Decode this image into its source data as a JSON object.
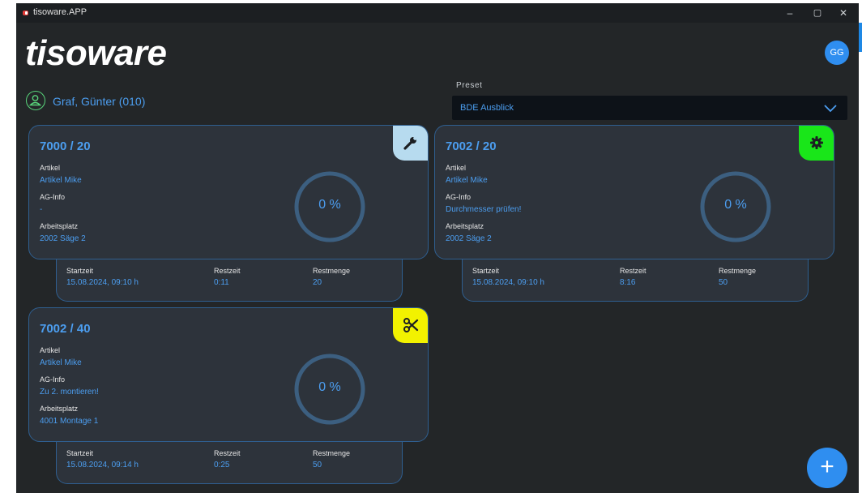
{
  "window": {
    "title": "tisoware.APP"
  },
  "controls": {
    "minimize": "–",
    "maximize": "▢",
    "close": "✕"
  },
  "header": {
    "logo": "tisoware",
    "avatar": "GG"
  },
  "user": {
    "name": "Graf, Günter (010)"
  },
  "preset": {
    "label": "Preset",
    "value": "BDE Ausblick"
  },
  "labels": {
    "artikel": "Artikel",
    "ag_info": "AG-Info",
    "arbeitsplatz": "Arbeitsplatz",
    "startzeit": "Startzeit",
    "restzeit": "Restzeit",
    "restmenge": "Restmenge"
  },
  "cards": [
    {
      "title": "7000 / 20",
      "artikel": "Artikel Mike",
      "ag_info": "-",
      "arbeitsplatz": "2002 Säge 2",
      "progress": "0 %",
      "startzeit": "15.08.2024, 09:10 h",
      "restzeit": "0:11",
      "restmenge": "20",
      "icon": "wrench-icon",
      "accent": "#b7dbef"
    },
    {
      "title": "7002 / 20",
      "artikel": "Artikel Mike",
      "ag_info": "Durchmesser prüfen!",
      "arbeitsplatz": "2002 Säge 2",
      "progress": "0 %",
      "startzeit": "15.08.2024, 09:10 h",
      "restzeit": "8:16",
      "restmenge": "50",
      "icon": "gear-icon",
      "accent": "#19e619"
    },
    {
      "title": "7002 / 40",
      "artikel": "Artikel Mike",
      "ag_info": "Zu 2. montieren!",
      "arbeitsplatz": "4001 Montage 1",
      "progress": "0 %",
      "startzeit": "15.08.2024, 09:14 h",
      "restzeit": "0:25",
      "restmenge": "50",
      "icon": "scissors-icon",
      "accent": "#f2f200"
    }
  ],
  "fab": {
    "label": "+"
  },
  "colors": {
    "background": "#232628",
    "card": "#2d333b",
    "accent_text": "#4c9ef0",
    "primary": "#2f8ef0"
  }
}
